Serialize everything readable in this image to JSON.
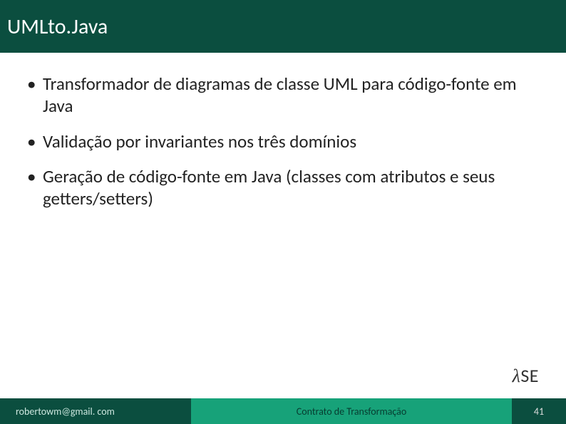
{
  "header": {
    "title": "UMLto.Java"
  },
  "bullets": [
    "Transformador de diagramas de classe UML para código-fonte em Java",
    "Validação por invariantes nos três domínios",
    "Geração de código-fonte em Java (classes com atributos e seus getters/setters)"
  ],
  "logo": {
    "lambda": "λ",
    "text": "SE"
  },
  "footer": {
    "email": "robertowm@gmail. com",
    "center": "Contrato de Transformação",
    "page": "41"
  }
}
